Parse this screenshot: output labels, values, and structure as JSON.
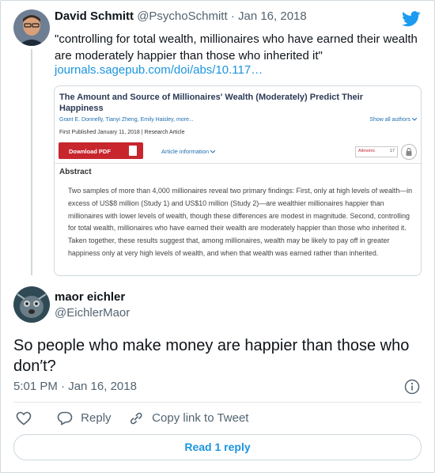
{
  "tweet": {
    "author_name": "David Schmitt",
    "handle": "@PsychoSchmitt",
    "separator": "·",
    "date": "Jan 16, 2018",
    "text": "\"controlling for total wealth, millionaires who have earned their wealth are moderately happier than those who inherited it\"",
    "link": "journals.sagepub.com/doi/abs/10.117…"
  },
  "card": {
    "title": "The Amount and Source of Millionaires' Wealth (Moderately) Predict Their Happiness",
    "authors": "Grant E. Donnelly, Tianyi Zheng, Emily Haisley, more...",
    "show_authors": "Show all authors",
    "meta": "First Published January 11, 2018 | Research Article",
    "download_label": "Download PDF",
    "article_info": "Article information",
    "altmetric_label": "Altmetric",
    "altmetric_score": "17",
    "abstract_heading": "Abstract",
    "abstract_text": "Two samples of more than 4,000 millionaires reveal two primary findings: First, only at high levels of wealth—in excess of US$8 million (Study 1) and US$10 million (Study 2)—are wealthier millionaires happier than millionaires with lower levels of wealth, though these differences are modest in magnitude. Second, controlling for total wealth, millionaires who have earned their wealth are moderately happier than those who inherited it. Taken together, these results suggest that, among millionaires, wealth may be likely to pay off in greater happiness only at very high levels of wealth, and when that wealth was earned rather than inherited."
  },
  "reply": {
    "author_name": "maor eichler",
    "handle": "@EichlerMaor",
    "text": "So people who make money are happier than those who don′t?",
    "timestamp": "5:01 PM · Jan 16, 2018"
  },
  "actions": {
    "reply_label": "Reply",
    "copy_label": "Copy link to Tweet",
    "read_replies": "Read 1 reply"
  },
  "colors": {
    "link": "#1b95e0",
    "muted": "#536471",
    "pdf_red": "#c8262d"
  }
}
